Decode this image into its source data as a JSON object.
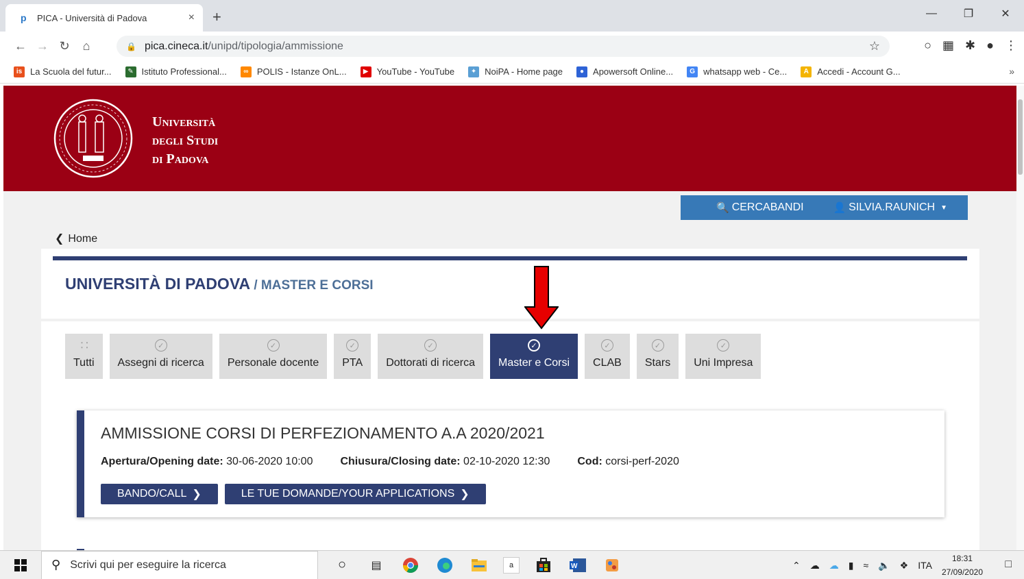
{
  "browser": {
    "tab_title": "PICA - Università di Padova",
    "tab_close": "×",
    "new_tab": "+",
    "url_host": "pica.cineca.it",
    "url_path": "/unipd/tipologia/ammissione",
    "bookmarks": [
      {
        "label": "La Scuola del futur...",
        "color": "#e8501c",
        "icon": "is"
      },
      {
        "label": "Istituto Professional...",
        "color": "#2b6c2f",
        "icon": "✎"
      },
      {
        "label": "POLIS - Istanze OnL...",
        "color": "#ff8800",
        "icon": "∞"
      },
      {
        "label": "YouTube - YouTube",
        "color": "#e00000",
        "icon": "▶"
      },
      {
        "label": "NoiPA - Home page",
        "color": "#5a9fd4",
        "icon": "✦"
      },
      {
        "label": "Apowersoft Online...",
        "color": "#2e63d6",
        "icon": "●"
      },
      {
        "label": "whatsapp web - Ce...",
        "color": "#4285f4",
        "icon": "G"
      },
      {
        "label": "Accedi - Account G...",
        "color": "#f4b400",
        "icon": "A"
      }
    ],
    "bookmarks_more": "»"
  },
  "site": {
    "university_line1": "Università",
    "university_line2": "degli Studi",
    "university_line3": "di Padova",
    "nav_search": "CERCABANDI",
    "nav_user": "SILVIA.RAUNICH",
    "home_link": "Home",
    "page_title_main": "UNIVERSITÀ DI PADOVA",
    "page_title_sub": " / MASTER E CORSI",
    "filters": [
      {
        "label": "Tutti",
        "active": false,
        "icon": "grid-icon"
      },
      {
        "label": "Assegni di ricerca",
        "active": false,
        "icon": "check-circle-icon"
      },
      {
        "label": "Personale docente",
        "active": false,
        "icon": "check-circle-icon"
      },
      {
        "label": "PTA",
        "active": false,
        "icon": "check-circle-icon"
      },
      {
        "label": "Dottorati di ricerca",
        "active": false,
        "icon": "check-circle-icon"
      },
      {
        "label": "Master e Corsi",
        "active": true,
        "icon": "check-circle-icon"
      },
      {
        "label": "CLAB",
        "active": false,
        "icon": "check-circle-icon"
      },
      {
        "label": "Stars",
        "active": false,
        "icon": "check-circle-icon"
      },
      {
        "label": "Uni Impresa",
        "active": false,
        "icon": "check-circle-icon"
      }
    ],
    "call": {
      "title": "AMMISSIONE CORSI DI PERFEZIONAMENTO A.A 2020/2021",
      "opening_label": "Apertura/Opening date:",
      "opening_value": "30-06-2020 10:00",
      "closing_label": "Chiusura/Closing date:",
      "closing_value": "02-10-2020 12:30",
      "cod_label": "Cod:",
      "cod_value": "corsi-perf-2020",
      "btn_call": "BANDO/CALL",
      "btn_applications": "LE TUE DOMANDE/YOUR APPLICATIONS"
    }
  },
  "taskbar": {
    "search_placeholder": "Scrivi qui per eseguire la ricerca",
    "lang": "ITA",
    "time": "18:31",
    "date": "27/09/2020"
  },
  "colors": {
    "brand_red": "#9b0014",
    "navy": "#2f3f73",
    "nav_blue": "#3779b7",
    "arrow_red": "#e60000"
  }
}
